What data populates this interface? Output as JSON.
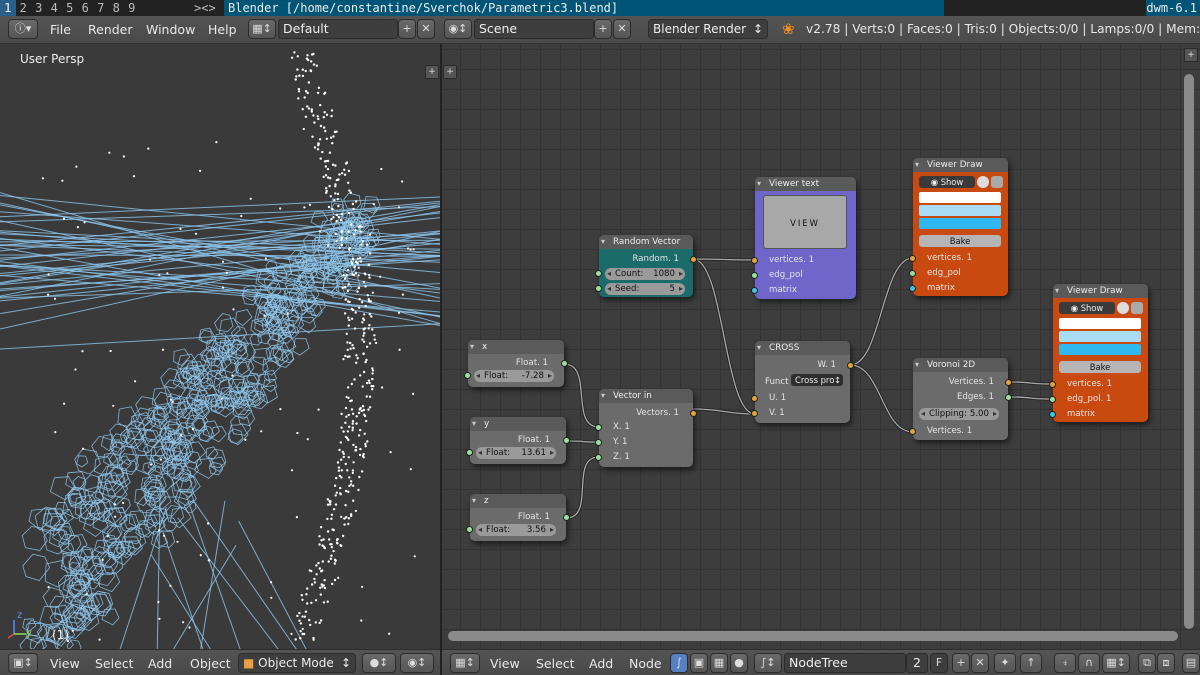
{
  "wm": {
    "tags": [
      "1",
      "2",
      "3",
      "4",
      "5",
      "6",
      "7",
      "8",
      "9"
    ],
    "layout": "><>",
    "title": "Blender [/home/constantine/Sverchok/Parametric3.blend]",
    "name": "dwm-6.1"
  },
  "info": {
    "menus": [
      "File",
      "Render",
      "Window",
      "Help"
    ],
    "screen": "Default",
    "scene": "Scene",
    "engine": "Blender Render",
    "stats": "v2.78 | Verts:0 | Faces:0 | Tris:0 | Objects:0/0 | Lamps:0/0 | Mem:15.77M"
  },
  "viewport": {
    "label": "User Persp",
    "frame": "(1)",
    "axis_z": "z",
    "axis_y": "y",
    "menus": [
      "View",
      "Select",
      "Add",
      "Object"
    ],
    "mode": "Object Mode"
  },
  "node_editor": {
    "menus": [
      "View",
      "Select",
      "Add",
      "Node"
    ],
    "tree": "NodeTree",
    "users": "2",
    "fake": "F"
  },
  "nodes": {
    "x": {
      "title": "x",
      "out": "Float. 1",
      "label": "Float:",
      "value": "-7.28"
    },
    "y": {
      "title": "y",
      "out": "Float. 1",
      "label": "Float:",
      "value": "13.61"
    },
    "z": {
      "title": "z",
      "out": "Float. 1",
      "label": "Float:",
      "value": "3.56"
    },
    "vector_in": {
      "title": "Vector in",
      "out": "Vectors. 1",
      "in_x": "X. 1",
      "in_y": "Y. 1",
      "in_z": "Z. 1"
    },
    "random_vector": {
      "title": "Random Vector",
      "out": "Random. 1",
      "count_label": "Count:",
      "count": "1080",
      "seed_label": "Seed:",
      "seed": "5"
    },
    "viewer_text": {
      "title": "Viewer text",
      "view": "VIEW",
      "in1": "vertices. 1",
      "in2": "edg_pol",
      "in3": "matrix"
    },
    "cross": {
      "title": "CROSS",
      "out": "W. 1",
      "funct_label": "Funct",
      "funct": "Cross pro",
      "in_u": "U. 1",
      "in_v": "V. 1"
    },
    "viewer_draw_1": {
      "title": "Viewer Draw",
      "show": "Show",
      "bake": "Bake",
      "in1": "vertices. 1",
      "in2": "edg_pol",
      "in3": "matrix"
    },
    "voronoi": {
      "title": "Voronoi 2D",
      "out1": "Vertices. 1",
      "out2": "Edges. 1",
      "clip_label": "Clipping:",
      "clip": "5.00",
      "in1": "Vertices. 1"
    },
    "viewer_draw_2": {
      "title": "Viewer Draw",
      "show": "Show",
      "bake": "Bake",
      "in1": "vertices. 1",
      "in2": "edg_pol. 1",
      "in3": "matrix"
    }
  },
  "colors": {
    "wm_title_bg": "#005577",
    "node_teal": "#1b6b6b",
    "node_purple": "#6e66c9",
    "node_orange": "#c84a10",
    "socket_vertex": "#e3a23a",
    "socket_float": "#9ae29a",
    "socket_matrix": "#3fc6e0",
    "wire_color": "#aaaaaa",
    "mesh_edges": "#8fc8f0",
    "swatch_blue": "#2fb8f0"
  },
  "icons": [
    "info-icon",
    "screen-layout-icon",
    "scene-icon",
    "blender-logo-icon",
    "plus-icon",
    "close-icon",
    "eye-icon",
    "fake-user-icon",
    "pin-icon",
    "snap-icon",
    "render-icon"
  ]
}
